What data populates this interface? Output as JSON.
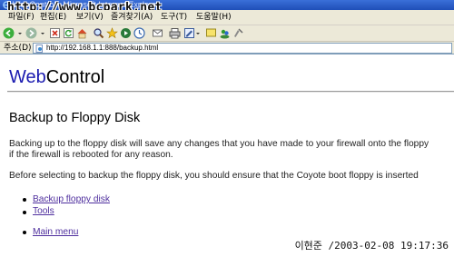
{
  "window": {
    "title": "WebControl - Microsoft Internet Explorer",
    "watermark": "http://www.bcpark.net"
  },
  "menu": [
    "파일(F)",
    "편집(E)",
    "보기(V)",
    "즐겨찾기(A)",
    "도구(T)",
    "도움말(H)"
  ],
  "toolbar": {
    "icons": [
      "back-icon",
      "forward-icon",
      "stop-icon",
      "refresh-icon",
      "home-icon",
      "search-icon",
      "favorites-icon",
      "media-icon",
      "history-icon",
      "mail-icon",
      "print-icon",
      "edit-icon",
      "discuss-icon",
      "messenger-icon",
      "research-icon"
    ]
  },
  "address": {
    "label": "주소(D)",
    "url": "http://192.168.1.1:888/backup.html"
  },
  "page": {
    "logo_web": "Web",
    "logo_control": "Control",
    "heading": "Backup to Floppy Disk",
    "para1_line1": "Backing up to the floppy disk will save any changes that you have made to your firewall onto the floppy",
    "para1_line2": "if the firewall is rebooted for any reason.",
    "para2": "Before selecting to backup the floppy disk, you should ensure that the Coyote boot floppy is inserted",
    "links": [
      "Backup floppy disk",
      "Tools",
      "Main menu"
    ]
  },
  "stamp": "이현준 /2003-02-08 19:17:36",
  "colors": {
    "titlebar": "#2a5fd0",
    "chrome": "#ece9d8",
    "logo_web": "#1a1ab0",
    "link": "#4f2f9e"
  }
}
